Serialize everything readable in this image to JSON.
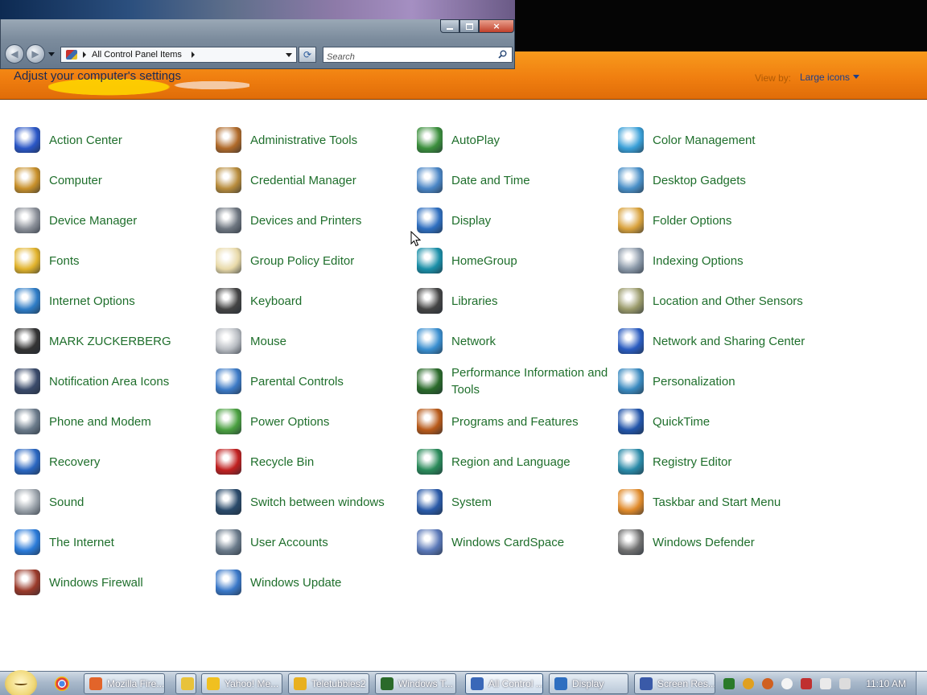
{
  "window": {
    "address": "All Control Panel Items",
    "search_placeholder": "Search",
    "caption": {
      "close_glyph": "×"
    }
  },
  "header": {
    "title": "Adjust your computer's settings",
    "view_by_label": "View by:",
    "view_by_value": "Large icons"
  },
  "items": [
    [
      "Action Center",
      "Administrative Tools",
      "AutoPlay",
      "Color Management"
    ],
    [
      "Computer",
      "Credential Manager",
      "Date and Time",
      "Desktop Gadgets"
    ],
    [
      "Device Manager",
      "Devices and Printers",
      "Display",
      "Folder Options"
    ],
    [
      "Fonts",
      "Group Policy Editor",
      "HomeGroup",
      "Indexing Options"
    ],
    [
      "Internet Options",
      "Keyboard",
      "Libraries",
      "Location and Other Sensors"
    ],
    [
      "MARK ZUCKERBERG",
      "Mouse",
      "Network",
      "Network and Sharing Center"
    ],
    [
      "Notification Area Icons",
      "Parental Controls",
      "Performance Information and Tools",
      "Personalization"
    ],
    [
      "Phone and Modem",
      "Power Options",
      "Programs and Features",
      "QuickTime"
    ],
    [
      "Recovery",
      "Recycle Bin",
      "Region and Language",
      "Registry Editor"
    ],
    [
      "Sound",
      "Switch between windows",
      "System",
      "Taskbar and Start Menu"
    ],
    [
      "The Internet",
      "User Accounts",
      "Windows CardSpace",
      "Windows Defender"
    ],
    [
      "Windows Firewall",
      "Windows Update",
      "",
      ""
    ]
  ],
  "icon_colors": [
    [
      "#2a56c6",
      "#b06a2a",
      "#3b8f3c",
      "#3aa0d8"
    ],
    [
      "#c8902a",
      "#b88c3c",
      "#4a86c6",
      "#4a90c8"
    ],
    [
      "#8a8f98",
      "#6e7680",
      "#2f6fc0",
      "#d9a23c"
    ],
    [
      "#e1b32c",
      "#e8d9a8",
      "#1a8fa8",
      "#8a98a8"
    ],
    [
      "#2e7cc6",
      "#444444",
      "#444444",
      "#9a9a6a"
    ],
    [
      "#333333",
      "#b8bcc2",
      "#3a8fd0",
      "#2a5cc0"
    ],
    [
      "#3a4a6a",
      "#3c7ac6",
      "#2a6a2a",
      "#3a8ac0"
    ],
    [
      "#6a7a8a",
      "#4aa040",
      "#b85a1a",
      "#2255aa"
    ],
    [
      "#2a66c0",
      "#c02020",
      "#2a8a5a",
      "#2a8aa8"
    ],
    [
      "#9aa2aa",
      "#2a4a6a",
      "#2a5aa8",
      "#e08a2a"
    ],
    [
      "#2a7ad8",
      "#6a7a8a",
      "#5a78b8",
      "#707070"
    ],
    [
      "#9a3a2a",
      "#3a78c8",
      "",
      ""
    ]
  ],
  "taskbar": {
    "buttons": [
      {
        "label": "Mozilla Fire...",
        "icon": "firefox-icon",
        "color": "#e2642a"
      },
      {
        "label": "",
        "icon": "folder-icon",
        "color": "#e8c23a"
      },
      {
        "label": "Yahoo! Me...",
        "icon": "messenger-icon",
        "color": "#f0c020"
      },
      {
        "label": "Teletubbies2",
        "icon": "image-icon",
        "color": "#e8b020"
      },
      {
        "label": "Windows T...",
        "icon": "task-manager-icon",
        "color": "#2a6a2a"
      },
      {
        "label": "All Control ...",
        "icon": "control-panel-icon",
        "color": "#3a68b8"
      },
      {
        "label": "Display",
        "icon": "display-icon",
        "color": "#2f6fc0"
      },
      {
        "label": "Screen Res...",
        "icon": "screen-resolution-icon",
        "color": "#3a5aa8"
      }
    ],
    "clock": "11:10 AM"
  }
}
